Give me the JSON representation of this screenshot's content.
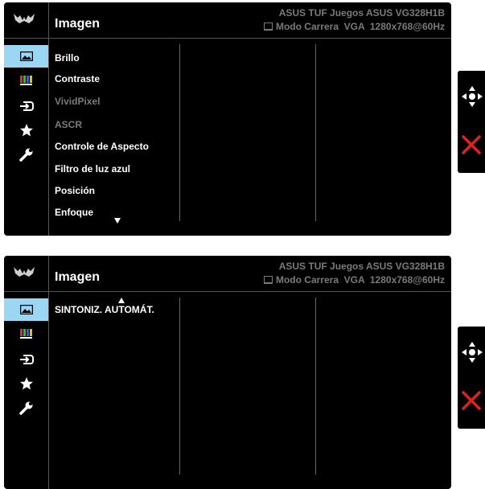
{
  "panels": [
    {
      "title": "Imagen",
      "model": "ASUS TUF Juegos ASUS VG328H1B",
      "mode_line": "Modo Carrera  VGA  1280x768@60Hz",
      "items": [
        {
          "label": "Brillo",
          "state": "enabled"
        },
        {
          "label": "Contraste",
          "state": "enabled"
        },
        {
          "label": "VividPixel",
          "state": "disabled"
        },
        {
          "label": "ASCR",
          "state": "disabled"
        },
        {
          "label": "Controle de Aspecto",
          "state": "enabled"
        },
        {
          "label": "Filtro de luz azul",
          "state": "enabled"
        },
        {
          "label": "Posición",
          "state": "enabled"
        },
        {
          "label": "Enfoque",
          "state": "enabled"
        }
      ],
      "scroll_indicator": "down"
    },
    {
      "title": "Imagen",
      "model": "ASUS TUF Juegos ASUS VG328H1B",
      "mode_line": "Modo Carrera  VGA  1280x768@60Hz",
      "items": [
        {
          "label": "SINTONIZ. AUTOMÁT.",
          "state": "enabled"
        }
      ],
      "scroll_indicator": "up"
    }
  ],
  "sidebar_icons": [
    "image-icon",
    "color-icon",
    "input-select-icon",
    "favorite-star-icon",
    "system-setup-wrench-icon"
  ],
  "active_sidebar_index": 0,
  "keypad_icons": [
    "five-way-joystick-icon",
    "close-x-icon"
  ],
  "colors": {
    "osd_bg": "#000000",
    "active_tab": "#9ad7f5",
    "dim_text": "#7a7a7a",
    "close": "#e02020"
  }
}
